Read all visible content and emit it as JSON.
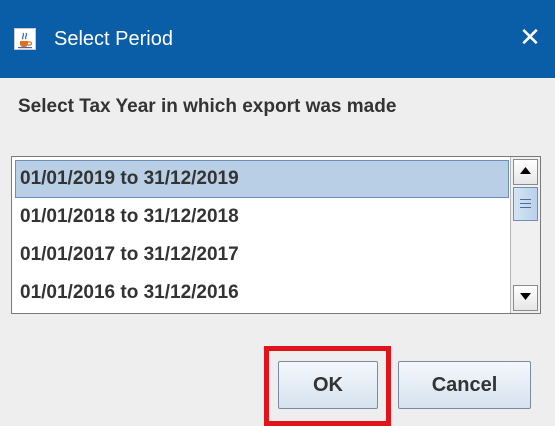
{
  "window": {
    "title": "Select Period",
    "app_icon": "java-cup-icon",
    "close_glyph": "✕",
    "titlebar_color": "#0a5ea8"
  },
  "prompt": "Select Tax Year in which export was made",
  "list": {
    "items": [
      "01/01/2019 to 31/12/2019",
      "01/01/2018 to 31/12/2018",
      "01/01/2017 to 31/12/2017",
      "01/01/2016 to 31/12/2016"
    ],
    "selected_index": 0,
    "selected_color": "#b8cfe5"
  },
  "buttons": {
    "ok": "OK",
    "cancel": "Cancel"
  },
  "annotation": {
    "highlight_color": "#e2141b",
    "highlighted": "ok"
  }
}
